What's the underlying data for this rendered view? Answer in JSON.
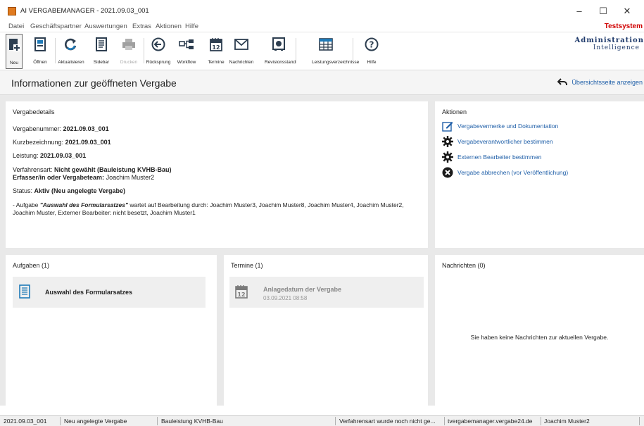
{
  "window": {
    "title": "AI VERGABEMANAGER - 2021.09.03_001",
    "controls": {
      "minimize": "–",
      "maximize": "☐",
      "close": "✕"
    }
  },
  "menu": {
    "items": [
      "Datei",
      "Geschäftspartner",
      "Auswertungen",
      "Extras",
      "Aktionen",
      "Hilfe"
    ],
    "environment": "Testsystem"
  },
  "toolbar": {
    "buttons": [
      {
        "label": "Neu",
        "icon": "new-document-icon"
      },
      {
        "label": "Öffnen",
        "icon": "open-icon"
      },
      {
        "label": "Aktualisieren",
        "icon": "refresh-icon"
      },
      {
        "label": "Sidebar",
        "icon": "sidebar-icon"
      },
      {
        "label": "Drucken",
        "icon": "print-icon",
        "disabled": true
      },
      {
        "label": "Rücksprung",
        "icon": "back-arrow-icon"
      },
      {
        "label": "Workflow",
        "icon": "workflow-icon"
      },
      {
        "label": "Termine",
        "icon": "calendar-icon"
      },
      {
        "label": "Nachrichten",
        "icon": "mail-icon"
      },
      {
        "label": "Revisionsstand",
        "icon": "safe-icon"
      },
      {
        "label": "Leistungsverzeichnisse",
        "icon": "spreadsheet-icon"
      },
      {
        "label": "Hilfe",
        "icon": "help-icon"
      }
    ],
    "logo": {
      "line1": "Administration",
      "line2": "Intelligence"
    }
  },
  "page": {
    "title": "Informationen zur geöffneten Vergabe",
    "overview_link": "Übersichtsseite anzeigen"
  },
  "details": {
    "title": "Vergabedetails",
    "vergabenummer_label": "Vergabenummer: ",
    "vergabenummer": "2021.09.03_001",
    "kurzbezeichnung_label": "Kurzbezeichnung: ",
    "kurzbezeichnung": "2021.09.03_001",
    "leistung_label": "Leistung: ",
    "leistung": "2021.09.03_001",
    "verfahrensart_label": "Verfahrensart: ",
    "verfahrensart": "Nicht gewählt (Bauleistung KVHB-Bau)",
    "erfasser_label": "Erfasser/in oder Vergabeteam: ",
    "erfasser": "Joachim Muster2",
    "status_label": "Status: ",
    "status": "Aktiv (Neu angelegte Vergabe)",
    "task_prefix": "- Aufgabe ",
    "task_name": "\"Auswahl des Formularsatzes\"",
    "task_suffix": " wartet auf Bearbeitung durch: Joachim Muster3, Joachim Muster8, Joachim Muster4, Joachim Muster2, Joachim Muster, Externer Bearbeiter: nicht besetzt, Joachim Muster1"
  },
  "actions": {
    "title": "Aktionen",
    "items": [
      {
        "label": "Vergabevermerke und Dokumentation",
        "icon": "edit-document-icon"
      },
      {
        "label": "Vergabeverantwortlicher bestimmen",
        "icon": "gear-icon"
      },
      {
        "label": "Externen Bearbeiter bestimmen",
        "icon": "gear-icon"
      },
      {
        "label": "Vergabe abbrechen (vor Veröffentlichung)",
        "icon": "cancel-icon"
      }
    ]
  },
  "tasks": {
    "title": "Aufgaben (1)",
    "items": [
      {
        "label": "Auswahl des Formularsatzes"
      }
    ]
  },
  "appointments": {
    "title": "Termine (1)",
    "items": [
      {
        "title": "Anlagedatum der Vergabe",
        "date": "03.09.2021 08:58"
      }
    ]
  },
  "messages": {
    "title": "Nachrichten (0)",
    "empty_text": "Sie haben keine Nachrichten zur aktuellen Vergabe."
  },
  "statusbar": [
    "2021.09.03_001",
    "Neu angelegte Vergabe",
    "Bauleistung KVHB-Bau",
    "Verfahrensart wurde noch nicht ge...",
    "tvergabemanager.vergabe24.de",
    "Joachim Muster2"
  ],
  "colors": {
    "link": "#1f5fa8",
    "environment": "#d00000",
    "panel_bg": "#e9e9e9"
  }
}
